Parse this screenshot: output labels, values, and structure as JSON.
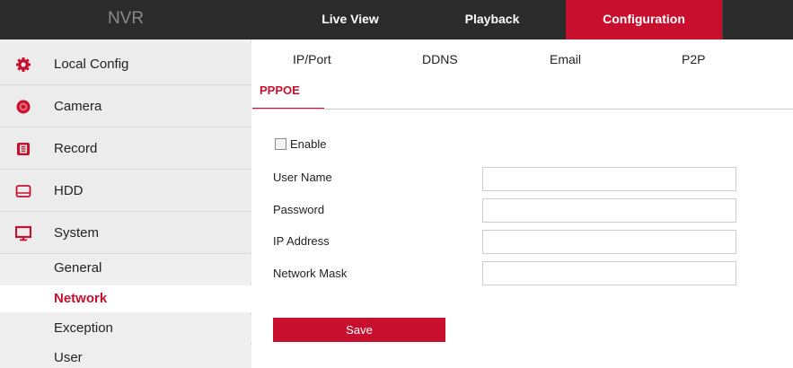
{
  "app": {
    "brand": "NVR",
    "accent_color": "#c8102e"
  },
  "top_nav": [
    {
      "label": "Live View",
      "active": false
    },
    {
      "label": "Playback",
      "active": false
    },
    {
      "label": "Configuration",
      "active": true
    }
  ],
  "sidebar": {
    "items": [
      {
        "label": "Local Config",
        "icon": "gear-icon"
      },
      {
        "label": "Camera",
        "icon": "camera-icon"
      },
      {
        "label": "Record",
        "icon": "record-icon"
      },
      {
        "label": "HDD",
        "icon": "hdd-icon"
      },
      {
        "label": "System",
        "icon": "monitor-icon"
      }
    ],
    "sub_items": [
      {
        "label": "General",
        "active": false
      },
      {
        "label": "Network",
        "active": true
      },
      {
        "label": "Exception",
        "active": false
      },
      {
        "label": "User",
        "active": false
      }
    ]
  },
  "sub_tabs": [
    "IP/Port",
    "DDNS",
    "Email",
    "P2P"
  ],
  "section_tab": "PPPOE",
  "form": {
    "enable_label": "Enable",
    "enable_checked": false,
    "fields": [
      {
        "label": "User Name",
        "value": ""
      },
      {
        "label": "Password",
        "value": ""
      },
      {
        "label": "IP Address",
        "value": ""
      },
      {
        "label": "Network Mask",
        "value": ""
      }
    ],
    "save_label": "Save"
  }
}
